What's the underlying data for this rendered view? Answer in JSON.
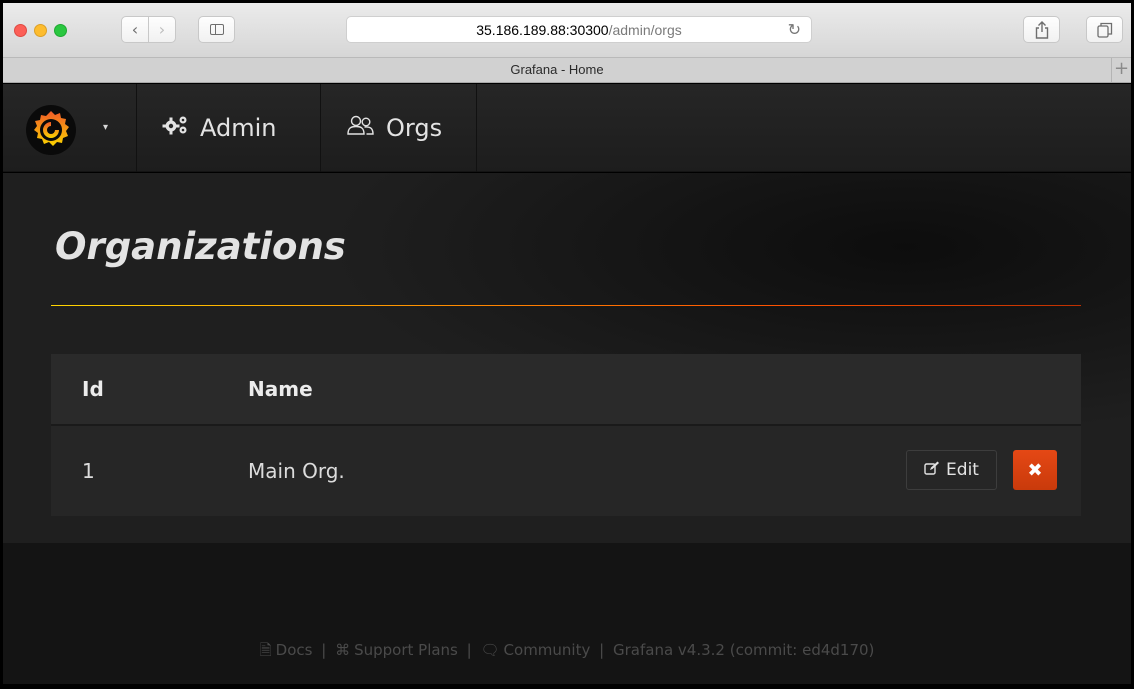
{
  "browser": {
    "url_host": "35.186.189.88:30300",
    "url_path": "/admin/orgs",
    "tab_title": "Grafana - Home",
    "back_icon": "chevron-left-icon",
    "forward_icon": "chevron-right-icon",
    "reload_icon": "reload-icon",
    "share_icon": "share-icon",
    "tabs_icon": "tabs-overview-icon",
    "new_tab_label": "+"
  },
  "nav": {
    "admin_label": "Admin",
    "orgs_label": "Orgs",
    "admin_icon": "cogs-icon",
    "orgs_icon": "users-icon"
  },
  "page": {
    "title": "Organizations"
  },
  "table": {
    "headers": [
      "Id",
      "Name"
    ],
    "rows": [
      {
        "id": "1",
        "name": "Main Org.",
        "edit_label": "Edit",
        "delete_label": "✖"
      }
    ]
  },
  "footer": {
    "docs": "Docs",
    "support": "Support Plans",
    "community": "Community",
    "version": "Grafana v4.3.2 (commit: ed4d170)",
    "separator": "|"
  },
  "colors": {
    "accent_orange": "#e54815",
    "nav_bg": "#262626",
    "main_bg": "#1f1f1f"
  }
}
